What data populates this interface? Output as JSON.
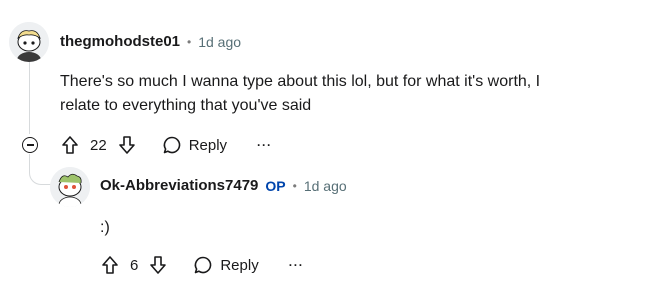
{
  "comments": [
    {
      "username": "thegmohodste01",
      "separator": "•",
      "time": "1d ago",
      "body_line1": "There's so much I wanna type about this lol, but for what it's worth, I",
      "body_line2": "relate to everything that you've said",
      "votes": "22",
      "reply_label": "Reply",
      "more_label": "···"
    },
    {
      "username": "Ok-Abbreviations7479",
      "op_badge": "OP",
      "separator": "•",
      "time": "1d ago",
      "body": ":)",
      "votes": "6",
      "reply_label": "Reply",
      "more_label": "···"
    }
  ],
  "colors": {
    "meta": "#576f76",
    "op": "#0045ac",
    "thread": "#d7dadc"
  }
}
